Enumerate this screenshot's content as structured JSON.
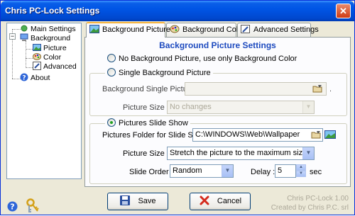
{
  "window": {
    "title": "Chris PC-Lock Settings",
    "close_label": "✕"
  },
  "tree": {
    "items": [
      {
        "label": "Main Settings",
        "icon": "tree-node-icon"
      },
      {
        "label": "Background",
        "icon": "computer-user-icon"
      },
      {
        "label": "Picture",
        "icon": "picture-icon"
      },
      {
        "label": "Color",
        "icon": "palette-icon"
      },
      {
        "label": "Advanced",
        "icon": "edit-pencil-icon"
      },
      {
        "label": "About",
        "icon": "help-icon"
      }
    ]
  },
  "tabs": [
    {
      "label": "Background Picture",
      "icon": "picture-icon",
      "active": true
    },
    {
      "label": "Background Color",
      "icon": "palette-icon",
      "active": false
    },
    {
      "label": "Advanced Settings",
      "icon": "edit-pencil-icon",
      "active": false
    }
  ],
  "panel": {
    "title": "Background Picture Settings",
    "option_none": "No Background Picture, use only Background Color",
    "option_single": "Single Background Picture",
    "single_picture_label": "Background Single Picture :",
    "single_picture_value": "",
    "single_picture_trailing": ".",
    "single_size_label": "Picture Size :",
    "single_size_value": "No changes",
    "option_slideshow": "Pictures Slide Show",
    "folder_label": "Pictures Folder for Slide Show :",
    "folder_value": "C:\\WINDOWS\\Web\\Wallpaper",
    "slide_size_label": "Picture Size :",
    "slide_size_value": "Stretch the picture to the maximum size",
    "order_label": "Slide Order :",
    "order_value": "Random",
    "delay_label": "Delay :",
    "delay_value": "5",
    "delay_unit": "sec",
    "selected_option": "slideshow"
  },
  "buttons": {
    "save": "Save",
    "cancel": "Cancel"
  },
  "footer": {
    "line1": "Chris PC-Lock 1.00",
    "line2": "Created by Chris P.C. srl"
  },
  "colors": {
    "title_blue": "#0055e5",
    "panel_title": "#1e4bbf",
    "tab_highlight": "#f6b33c"
  }
}
